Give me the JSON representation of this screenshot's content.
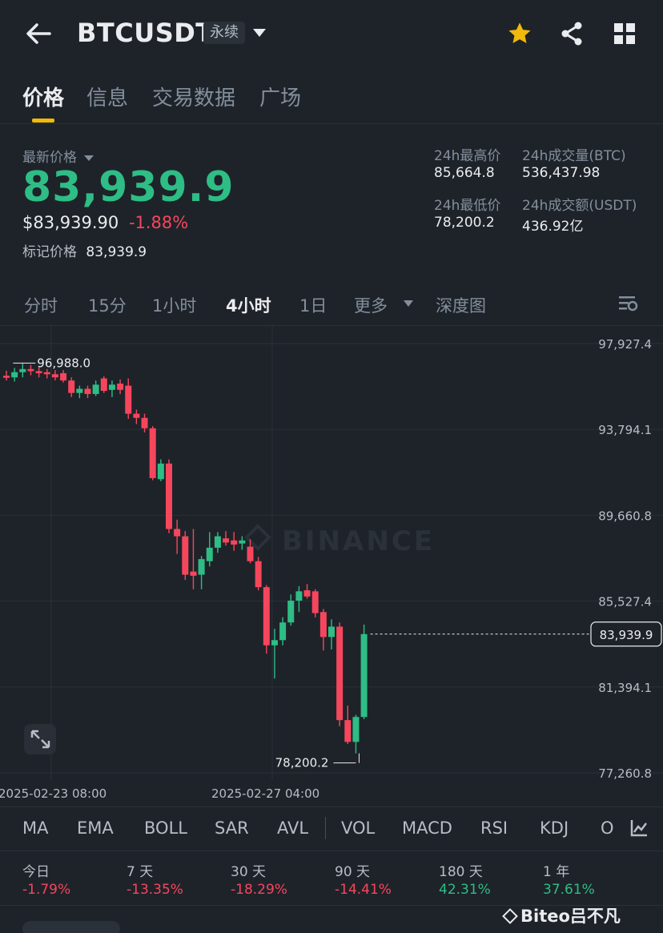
{
  "header": {
    "symbol": "BTCUSDT",
    "contract_type": "永续"
  },
  "tabs": [
    {
      "label": "价格"
    },
    {
      "label": "信息"
    },
    {
      "label": "交易数据"
    },
    {
      "label": "广场"
    }
  ],
  "price": {
    "last_label": "最新价格",
    "last": "83,939.9",
    "usd": "$83,939.90",
    "change_pct": "-1.88%",
    "mark_label": "标记价格",
    "mark": "83,939.9"
  },
  "stats24h": {
    "high_label": "24h最高价",
    "high": "85,664.8",
    "vol_btc_label": "24h成交量(BTC)",
    "vol_btc": "536,437.98",
    "low_label": "24h最低价",
    "low": "78,200.2",
    "vol_usdt_label": "24h成交额(USDT)",
    "vol_usdt": "436.92亿"
  },
  "intervals": [
    {
      "label": "分时"
    },
    {
      "label": "15分"
    },
    {
      "label": "1小时"
    },
    {
      "label": "4小时",
      "active": true
    },
    {
      "label": "1日"
    },
    {
      "label": "更多"
    },
    {
      "label": "深度图"
    }
  ],
  "chart_data": {
    "type": "candlestick",
    "y_ticks": [
      "97,927.4",
      "93,794.1",
      "89,660.8",
      "85,527.4",
      "81,394.1",
      "77,260.8"
    ],
    "ylim": [
      77260.8,
      97927.4
    ],
    "x_ticks": [
      "2025-02-23 08:00",
      "2025-02-27 04:00"
    ],
    "current_price_label": "83,939.9",
    "high_marker": "96,988.0",
    "low_marker": "78,200.2",
    "watermark": "BINANCE",
    "candles": [
      {
        "o": 96380,
        "h": 96620,
        "l": 96150,
        "c": 96280
      },
      {
        "o": 96300,
        "h": 96750,
        "l": 96100,
        "c": 96550
      },
      {
        "o": 96550,
        "h": 96988,
        "l": 96300,
        "c": 96700
      },
      {
        "o": 96700,
        "h": 96900,
        "l": 96400,
        "c": 96600
      },
      {
        "o": 96600,
        "h": 96800,
        "l": 96300,
        "c": 96500
      },
      {
        "o": 96550,
        "h": 96700,
        "l": 96250,
        "c": 96450
      },
      {
        "o": 96450,
        "h": 96650,
        "l": 96150,
        "c": 96300
      },
      {
        "o": 96500,
        "h": 96650,
        "l": 96050,
        "c": 96150
      },
      {
        "o": 96150,
        "h": 96300,
        "l": 95350,
        "c": 95550
      },
      {
        "o": 95550,
        "h": 95900,
        "l": 95300,
        "c": 95750
      },
      {
        "o": 95750,
        "h": 95900,
        "l": 95300,
        "c": 95500
      },
      {
        "o": 95500,
        "h": 96150,
        "l": 95400,
        "c": 95950
      },
      {
        "o": 96250,
        "h": 96350,
        "l": 95550,
        "c": 95650
      },
      {
        "o": 95700,
        "h": 96150,
        "l": 95350,
        "c": 95950
      },
      {
        "o": 96000,
        "h": 96200,
        "l": 95500,
        "c": 95700
      },
      {
        "o": 95900,
        "h": 96250,
        "l": 94300,
        "c": 94550
      },
      {
        "o": 94550,
        "h": 94750,
        "l": 94050,
        "c": 94350
      },
      {
        "o": 94350,
        "h": 94550,
        "l": 93650,
        "c": 93850
      },
      {
        "o": 93850,
        "h": 93950,
        "l": 91350,
        "c": 91450
      },
      {
        "o": 91400,
        "h": 92350,
        "l": 91300,
        "c": 92150
      },
      {
        "o": 92150,
        "h": 92350,
        "l": 88800,
        "c": 89000
      },
      {
        "o": 89000,
        "h": 89450,
        "l": 87800,
        "c": 88650
      },
      {
        "o": 88650,
        "h": 88900,
        "l": 86550,
        "c": 86800
      },
      {
        "o": 86950,
        "h": 89000,
        "l": 86100,
        "c": 86750
      },
      {
        "o": 86800,
        "h": 87700,
        "l": 86100,
        "c": 87550
      },
      {
        "o": 87450,
        "h": 88850,
        "l": 87200,
        "c": 88100
      },
      {
        "o": 88100,
        "h": 88850,
        "l": 87850,
        "c": 88650
      },
      {
        "o": 88550,
        "h": 88900,
        "l": 88200,
        "c": 88350
      },
      {
        "o": 88450,
        "h": 88850,
        "l": 87950,
        "c": 88250
      },
      {
        "o": 88300,
        "h": 88650,
        "l": 88000,
        "c": 88450
      },
      {
        "o": 88150,
        "h": 88500,
        "l": 87350,
        "c": 87450
      },
      {
        "o": 87450,
        "h": 87650,
        "l": 86050,
        "c": 86200
      },
      {
        "o": 86200,
        "h": 86300,
        "l": 83000,
        "c": 83400
      },
      {
        "o": 83400,
        "h": 84200,
        "l": 81800,
        "c": 83650
      },
      {
        "o": 83650,
        "h": 84750,
        "l": 83400,
        "c": 84500
      },
      {
        "o": 84500,
        "h": 85850,
        "l": 84350,
        "c": 85550
      },
      {
        "o": 85550,
        "h": 86250,
        "l": 85000,
        "c": 86000
      },
      {
        "o": 86050,
        "h": 86350,
        "l": 85650,
        "c": 85750
      },
      {
        "o": 86000,
        "h": 86100,
        "l": 84750,
        "c": 84950
      },
      {
        "o": 85000,
        "h": 85150,
        "l": 83150,
        "c": 83800
      },
      {
        "o": 83800,
        "h": 84650,
        "l": 83200,
        "c": 84300
      },
      {
        "o": 84300,
        "h": 84500,
        "l": 79500,
        "c": 79800
      },
      {
        "o": 79800,
        "h": 80500,
        "l": 78650,
        "c": 78750
      },
      {
        "o": 78750,
        "h": 80050,
        "l": 78200,
        "c": 79950
      },
      {
        "o": 79950,
        "h": 84400,
        "l": 79850,
        "c": 83940
      }
    ]
  },
  "indicators": [
    "MA",
    "EMA",
    "BOLL",
    "SAR",
    "AVL",
    "VOL",
    "MACD",
    "RSI",
    "KDJ",
    "O"
  ],
  "performance": [
    {
      "label": "今日",
      "value": "-1.79%",
      "color": "red"
    },
    {
      "label": "7 天",
      "value": "-13.35%",
      "color": "red"
    },
    {
      "label": "30 天",
      "value": "-18.29%",
      "color": "red"
    },
    {
      "label": "90 天",
      "value": "-14.41%",
      "color": "red"
    },
    {
      "label": "180 天",
      "value": "42.31%",
      "color": "green"
    },
    {
      "label": "1 年",
      "value": "37.61%",
      "color": "green"
    }
  ],
  "watermark_user": "Biteo吕不凡",
  "colors": {
    "up": "#2ebd85",
    "down": "#f6465d",
    "accent": "#f0b90b",
    "bg": "#1e2329"
  }
}
